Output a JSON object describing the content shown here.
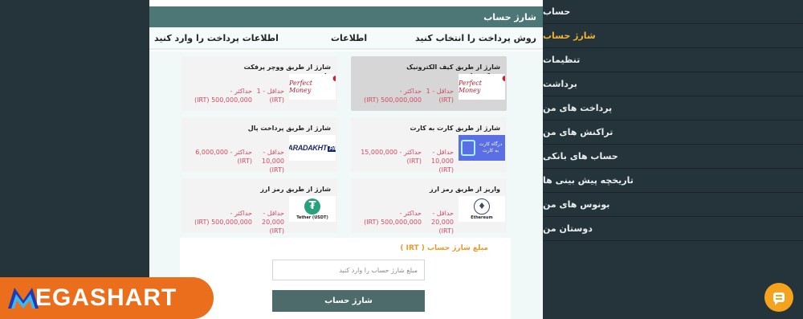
{
  "sidebar": {
    "items": [
      {
        "label": "حساب",
        "active": false
      },
      {
        "label": "شارژ حساب",
        "active": true
      },
      {
        "label": "تنظیمات",
        "active": false
      },
      {
        "label": "برداشت",
        "active": false
      },
      {
        "label": "پرداخت های من",
        "active": false
      },
      {
        "label": "تراکنش های من",
        "active": false
      },
      {
        "label": "حساب های بانکی",
        "active": false
      },
      {
        "label": "تاریخچه پیش بینی ها",
        "active": false
      },
      {
        "label": "بونوس های من",
        "active": false
      },
      {
        "label": "دوستان من",
        "active": false
      }
    ]
  },
  "panel": {
    "title": "شارژ حساب",
    "steps": [
      "روش پرداخت را انتخاب کنید",
      "اطلاعات",
      "اطلاعات پرداخت را وارد کنید"
    ]
  },
  "methods": [
    {
      "title": "شارژ از طریق کیف الکترونیک پرفکت مانی",
      "logo": "Perfect Money",
      "min": "حداقل - 1 (IRT)",
      "max": "حداکثر - 500,000,000 (IRT)",
      "selected": true
    },
    {
      "title": "شارژ از طریق ووچر پرفکت مانی",
      "logo": "Perfect Money",
      "min": "حداقل - 1 (IRT)",
      "max": "حداکثر - 500,000,000 (IRT)",
      "selected": false
    },
    {
      "title": "شارژ از طریق کارت به کارت",
      "logo": "درگاه کارت به کارت",
      "min": "حداقل - 10,000 (IRT)",
      "max": "حداکثر - 15,000,000 (IRT)",
      "selected": false
    },
    {
      "title": "شارژ از طریق پرداخت پال",
      "logo": "PARADAKHT PAL",
      "min": "حداقل - 10,000 (IRT)",
      "max": "حداکثر - 6,000,000 (IRT)",
      "selected": false
    },
    {
      "title": "واریز از طریق رمز ارز",
      "logo": "Ethereum",
      "min": "حداقل - 20,000 (IRT)",
      "max": "حداکثر - 500,000,000 (IRT)",
      "selected": false
    },
    {
      "title": "شارژ از طریق رمز ارز",
      "logo": "Tether (USDT)",
      "min": "حداقل - 20,000 (IRT)",
      "max": "حداکثر - 500,000,000 (IRT)",
      "selected": false
    }
  ],
  "amount": {
    "label": "مبلغ شارژ حساب ( IRT )",
    "placeholder": "مبلغ شارژ حساب را وارد کنید",
    "submit": "شارژ حساب"
  },
  "brand": {
    "text": "EGASHART"
  },
  "colors": {
    "accent": "#f2b330",
    "header": "#4d7677",
    "price": "#d24a63",
    "brand": "#ea6e1b"
  }
}
